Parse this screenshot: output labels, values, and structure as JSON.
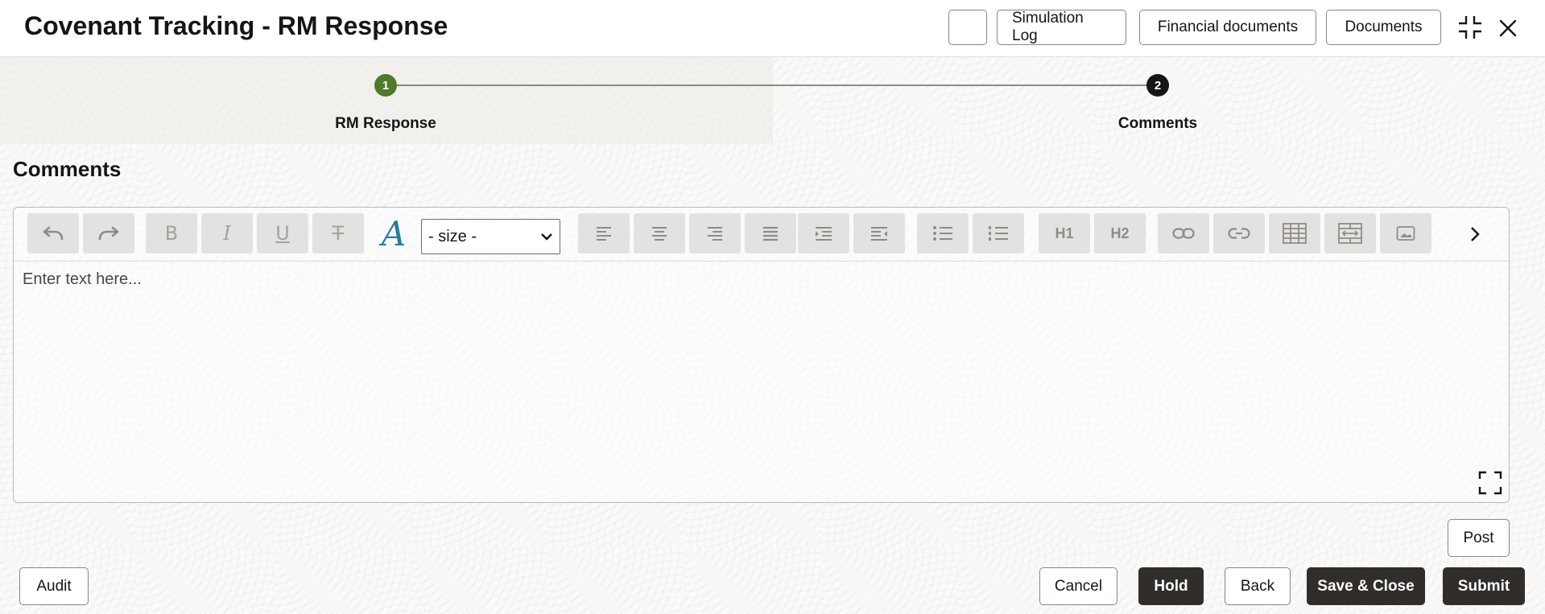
{
  "header": {
    "title": "Covenant Tracking - RM Response",
    "buttons": {
      "blank": "",
      "simulation_log": "Simulation Log",
      "financial_documents": "Financial documents",
      "documents": "Documents"
    },
    "icons": {
      "collapse": "collapse-icon",
      "close": "close-icon"
    }
  },
  "train": {
    "steps": [
      {
        "number": "1",
        "label": "RM Response",
        "state": "completed",
        "color": "#4f7a28"
      },
      {
        "number": "2",
        "label": "Comments",
        "state": "current",
        "color": "#161513"
      }
    ]
  },
  "section": {
    "title": "Comments"
  },
  "editor": {
    "toolbar": {
      "size_select": "- size -",
      "items": [
        "undo",
        "redo",
        "bold",
        "italic",
        "underline",
        "strikethrough",
        "font-color",
        "size",
        "align-left",
        "align-center",
        "align-right",
        "justify",
        "indent",
        "outdent",
        "bullet-list",
        "numbered-list",
        "heading-1",
        "heading-2",
        "link",
        "unlink",
        "table",
        "table-split",
        "image",
        "more"
      ],
      "h1": "H1",
      "h2": "H2"
    },
    "placeholder": "Enter text here...",
    "expand_icon": "expand-icon"
  },
  "actions": {
    "post": "Post",
    "audit": "Audit",
    "cancel": "Cancel",
    "hold": "Hold",
    "back": "Back",
    "save_close": "Save & Close",
    "submit": "Submit"
  },
  "colors": {
    "primary_dark": "#312d2a",
    "step_complete": "#4f7a28",
    "font_color_icon": "#227e9e"
  }
}
